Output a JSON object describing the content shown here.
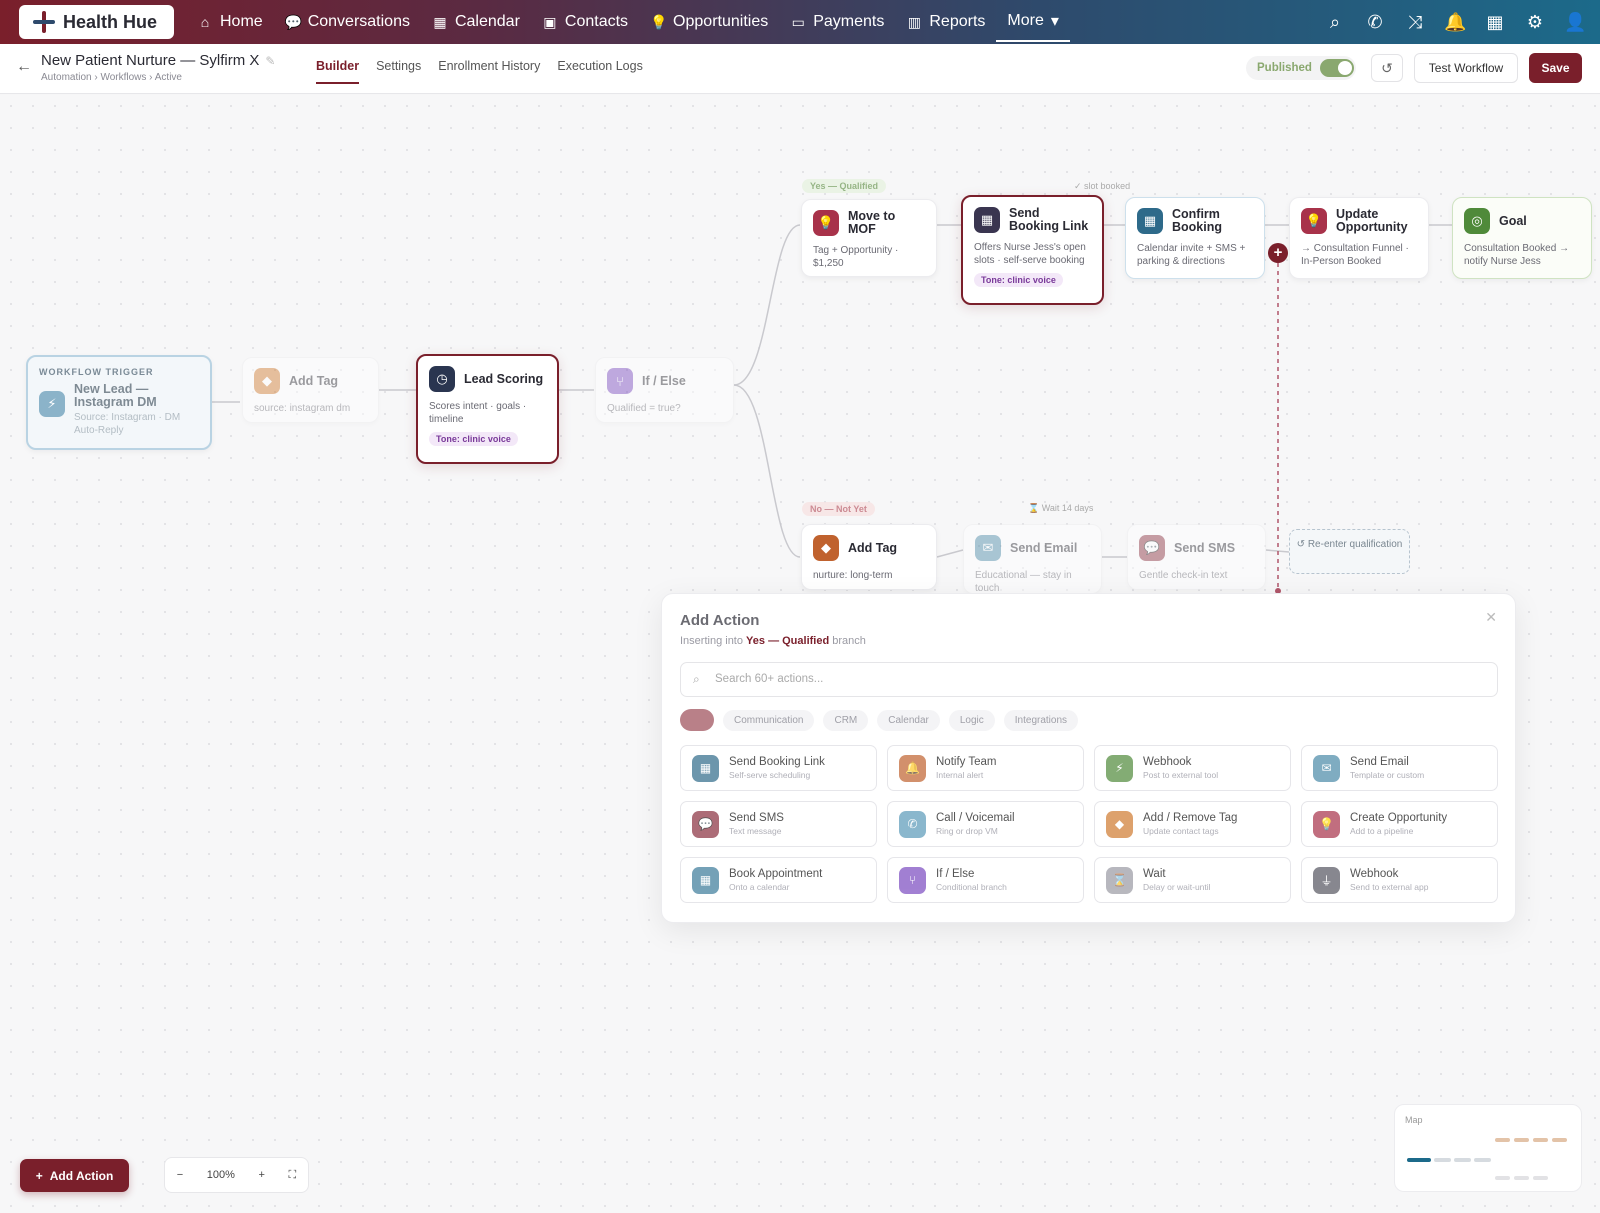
{
  "nav": {
    "brand": "Health Hue",
    "items": [
      {
        "label": "Home",
        "icon": "home-icon",
        "glyph": "⌂"
      },
      {
        "label": "Conversations",
        "icon": "chat-icon",
        "glyph": "💬"
      },
      {
        "label": "Calendar",
        "icon": "calendar-icon",
        "glyph": "▦"
      },
      {
        "label": "Contacts",
        "icon": "contacts-icon",
        "glyph": "▣"
      },
      {
        "label": "Opportunities",
        "icon": "bulb-icon",
        "glyph": "💡"
      },
      {
        "label": "Payments",
        "icon": "card-icon",
        "glyph": "▭"
      },
      {
        "label": "Reports",
        "icon": "chart-icon",
        "glyph": "▥"
      }
    ],
    "more": "More",
    "accent": "#7a1f2b"
  },
  "header": {
    "title": "New Patient Nurture — Sylfirm X",
    "breadcrumb": "Automation › Workflows › Active",
    "tabs": [
      "Builder",
      "Settings",
      "Enrollment History",
      "Execution Logs"
    ],
    "published": "Published",
    "test": "Test Workflow",
    "save": "Save"
  },
  "nodes": {
    "trigger": {
      "label": "WORKFLOW TRIGGER",
      "title": "New Lead — Instagram DM",
      "desc": "Source: Instagram · DM Auto-Reply"
    },
    "add_tag_1": {
      "title": "Add Tag",
      "desc": "source: instagram dm"
    },
    "lead_scoring": {
      "title": "Lead Scoring",
      "desc": "Scores intent · goals · timeline",
      "tone": "Tone: clinic voice"
    },
    "if_else": {
      "title": "If / Else",
      "desc": "Qualified = true?"
    },
    "move_mof": {
      "title": "Move to MOF",
      "desc": "Tag + Opportunity · $1,250"
    },
    "booking_link": {
      "title": "Send Booking Link",
      "desc": "Offers Nurse Jess's open slots · self-serve booking",
      "tone": "Tone: clinic voice"
    },
    "confirm": {
      "title": "Confirm Booking",
      "desc": "Calendar invite + SMS + parking & directions"
    },
    "update_opp": {
      "title": "Update Opportunity",
      "desc": "→ Consultation Funnel · In-Person Booked"
    },
    "goal": {
      "title": "Goal",
      "desc": "Consultation Booked → notify Nurse Jess"
    },
    "add_tag_2": {
      "title": "Add Tag",
      "desc": "nurture: long-term"
    },
    "send_email": {
      "title": "Send Email",
      "desc": "Educational — stay in touch"
    },
    "send_sms": {
      "title": "Send SMS",
      "desc": "Gentle check-in text"
    },
    "reenter": "↺ Re-enter qualification"
  },
  "branches": {
    "yes": "Yes — Qualified",
    "no": "No — Not Yet",
    "slot": "✓ slot booked",
    "wait": "⌛ Wait 14 days"
  },
  "panel": {
    "title": "Add Action",
    "sub_prefix": "Inserting into",
    "sub_branch": "Yes — Qualified",
    "sub_suffix": "branch",
    "search_placeholder": "Search 60+ actions...",
    "chips": [
      "Communication",
      "CRM",
      "Calendar",
      "Logic",
      "Integrations"
    ],
    "cards": [
      {
        "title": "Send Booking Link",
        "sub": "Self-serve scheduling",
        "color": "#2e6a8a",
        "glyph": "▦",
        "icon": "calendar-icon"
      },
      {
        "title": "Notify Team",
        "sub": "Internal alert",
        "color": "#c0622e",
        "glyph": "🔔",
        "icon": "bell-icon"
      },
      {
        "title": "Webhook",
        "sub": "Post to external tool",
        "color": "#4f8a3a",
        "glyph": "⚡",
        "icon": "bolt-icon"
      },
      {
        "title": "Send Email",
        "sub": "Template or custom",
        "color": "#4a8aa8",
        "glyph": "✉",
        "icon": "mail-icon"
      },
      {
        "title": "Send SMS",
        "sub": "Text message",
        "color": "#8a2f3e",
        "glyph": "💬",
        "icon": "sms-icon"
      },
      {
        "title": "Call / Voicemail",
        "sub": "Ring or drop VM",
        "color": "#5a9ab8",
        "glyph": "✆",
        "icon": "phone-icon"
      },
      {
        "title": "Add / Remove Tag",
        "sub": "Update contact tags",
        "color": "#d07a2e",
        "glyph": "◆",
        "icon": "tag-icon"
      },
      {
        "title": "Create Opportunity",
        "sub": "Add to a pipeline",
        "color": "#a8324a",
        "glyph": "💡",
        "icon": "bulb-icon"
      },
      {
        "title": "Book Appointment",
        "sub": "Onto a calendar",
        "color": "#3a7a9a",
        "glyph": "▦",
        "icon": "calendar-icon"
      },
      {
        "title": "If / Else",
        "sub": "Conditional branch",
        "color": "#7a4ac0",
        "glyph": "⑂",
        "icon": "branch-icon"
      },
      {
        "title": "Wait",
        "sub": "Delay or wait-until",
        "color": "#9a9aa3",
        "glyph": "⌛",
        "icon": "hourglass-icon"
      },
      {
        "title": "Webhook",
        "sub": "Send to external app",
        "color": "#555560",
        "glyph": "⏚",
        "icon": "plug-icon"
      }
    ]
  },
  "bottom": {
    "add_action": "Add Action",
    "zoom": "100%",
    "map": "Map"
  }
}
